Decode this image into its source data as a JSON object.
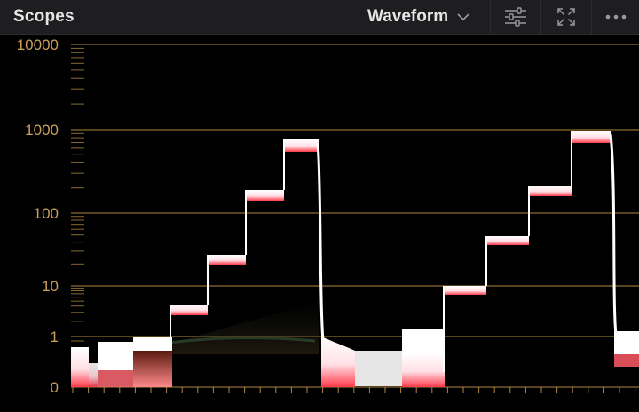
{
  "panel": {
    "title": "Scopes"
  },
  "toolbar": {
    "mode_label": "Waveform",
    "mode_icon": "chevron-down-icon",
    "settings_icon": "sliders-icon",
    "expand_icon": "expand-icon",
    "more_icon": "more-dots-icon"
  },
  "scale": {
    "labels": [
      "10000",
      "1000",
      "100",
      "10",
      "1",
      "0"
    ],
    "type": "log nits"
  },
  "colors": {
    "background": "#000000",
    "header": "#1e1e21",
    "grid": "#b08a3e",
    "label": "#caa05a",
    "trace": "#ffffff"
  }
}
